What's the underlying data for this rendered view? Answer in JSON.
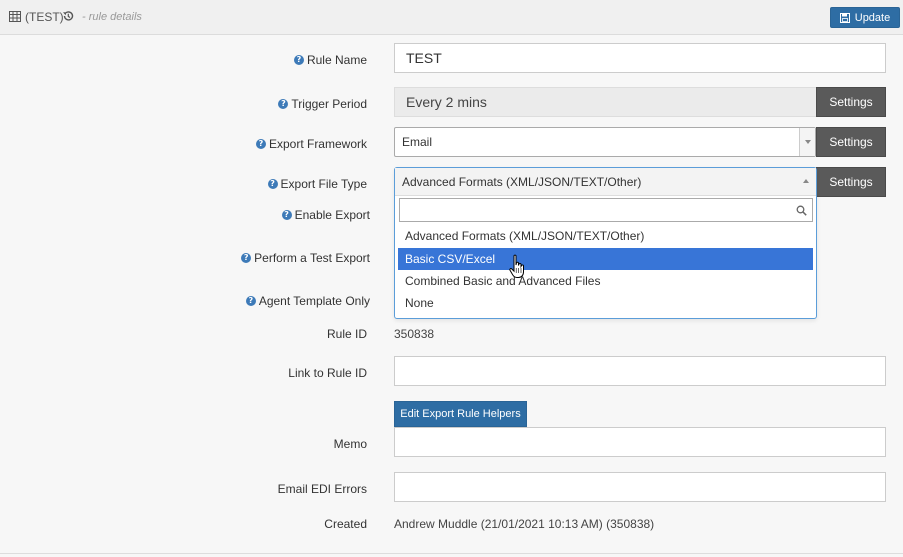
{
  "header": {
    "title": "(TEST)",
    "subtitle": "- rule details",
    "update_label": "Update"
  },
  "fields": {
    "rule_name": {
      "label": "Rule Name",
      "value": "TEST"
    },
    "trigger_period": {
      "label": "Trigger Period",
      "value": "Every 2 mins",
      "settings_label": "Settings"
    },
    "export_framework": {
      "label": "Export Framework",
      "value": "Email",
      "settings_label": "Settings"
    },
    "export_file_type": {
      "label": "Export File Type",
      "value": "Advanced Formats (XML/JSON/TEXT/Other)",
      "settings_label": "Settings"
    },
    "enable_export": {
      "label": "Enable Export"
    },
    "perform_test_export": {
      "label": "Perform a Test Export"
    },
    "agent_template_only": {
      "label": "Agent Template Only"
    },
    "rule_id": {
      "label": "Rule ID",
      "value": "350838"
    },
    "link_to_rule_id": {
      "label": "Link to Rule ID",
      "value": ""
    },
    "memo": {
      "label": "Memo",
      "helpers_label": "Edit Export Rule Helpers",
      "value": ""
    },
    "email_edi_errors": {
      "label": "Email EDI Errors",
      "value": ""
    },
    "created": {
      "label": "Created",
      "value": "Andrew Muddle (21/01/2021 10:13 AM) (350838)"
    }
  },
  "dropdown": {
    "search_value": "",
    "options": [
      "Advanced Formats (XML/JSON/TEXT/Other)",
      "Basic CSV/Excel",
      "Combined Basic and Advanced Files",
      "None"
    ],
    "highlighted": "Basic CSV/Excel"
  },
  "icons": {
    "table": "table-icon",
    "history": "history-icon",
    "save": "floppy-disk-icon",
    "help": "question-circle-icon",
    "search": "search-icon",
    "cursor": "hand-pointer-cursor-icon"
  },
  "colors": {
    "primary_button": "#2e6da4",
    "settings_button": "#5a5a5a",
    "highlight": "#3875d7",
    "help_icon": "#3d7ab8"
  }
}
